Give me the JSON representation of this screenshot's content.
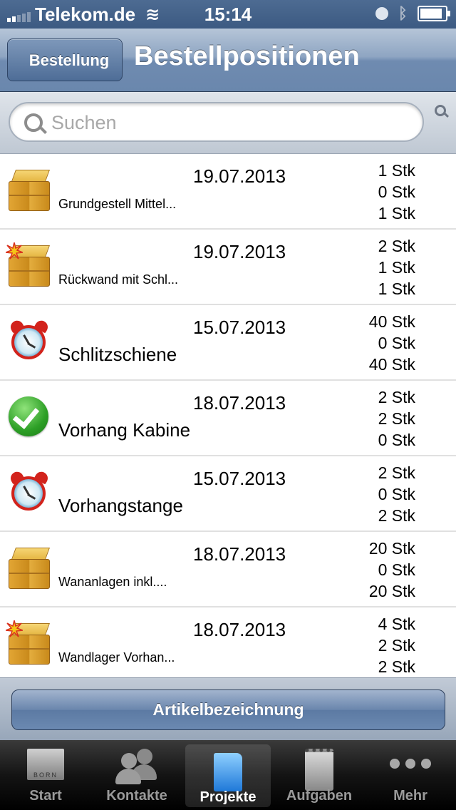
{
  "status": {
    "carrier": "Telekom.de",
    "time": "15:14",
    "icons": [
      "signal-icon",
      "wifi-icon",
      "clock-icon",
      "bluetooth-icon",
      "battery-icon"
    ]
  },
  "nav": {
    "back_label": "Bestellung",
    "title": "Bestellpositionen"
  },
  "search": {
    "placeholder": "Suchen"
  },
  "rows": [
    {
      "icon": "package-icon",
      "date": "19.07.2013",
      "name": "Grundgestell Mittel...",
      "name_size": "small",
      "qty": [
        "1 Stk",
        "0 Stk",
        "1 Stk"
      ]
    },
    {
      "icon": "package-new-icon",
      "date": "19.07.2013",
      "name": "Rückwand mit Schl...",
      "name_size": "small",
      "qty": [
        "2 Stk",
        "1 Stk",
        "1 Stk"
      ]
    },
    {
      "icon": "alarm-clock-icon",
      "date": "15.07.2013",
      "name": "Schlitzschiene",
      "name_size": "large",
      "qty": [
        "40 Stk",
        "0 Stk",
        "40 Stk"
      ]
    },
    {
      "icon": "checkmark-icon",
      "date": "18.07.2013",
      "name": "Vorhang Kabine",
      "name_size": "large",
      "qty": [
        "2 Stk",
        "2 Stk",
        "0 Stk"
      ]
    },
    {
      "icon": "alarm-clock-icon",
      "date": "15.07.2013",
      "name": "Vorhangstange",
      "name_size": "large",
      "qty": [
        "2 Stk",
        "0 Stk",
        "2 Stk"
      ]
    },
    {
      "icon": "package-icon",
      "date": "18.07.2013",
      "name": "Wananlagen inkl....",
      "name_size": "small",
      "qty": [
        "20 Stk",
        "0 Stk",
        "20 Stk"
      ]
    },
    {
      "icon": "package-new-icon",
      "date": "18.07.2013",
      "name": "Wandlager Vorhan...",
      "name_size": "small",
      "qty": [
        "4 Stk",
        "2 Stk",
        "2 Stk"
      ]
    }
  ],
  "action": {
    "label": "Artikelbezeichnung"
  },
  "tabs": [
    {
      "label": "Start",
      "icon": "born-logo-icon",
      "active": false
    },
    {
      "label": "Kontakte",
      "icon": "contacts-icon",
      "active": false
    },
    {
      "label": "Projekte",
      "icon": "projects-book-icon",
      "active": true
    },
    {
      "label": "Aufgaben",
      "icon": "notepad-icon",
      "active": false
    },
    {
      "label": "Mehr",
      "icon": "more-dots-icon",
      "active": false
    }
  ]
}
